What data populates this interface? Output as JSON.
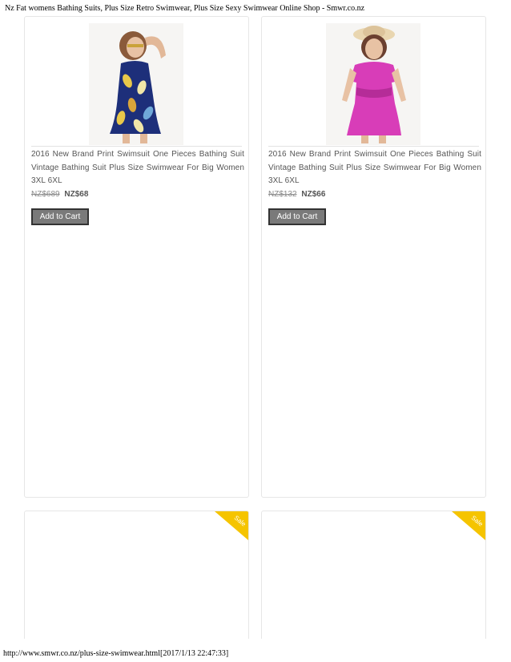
{
  "page": {
    "header_title": "Nz Fat womens Bathing Suits, Plus Size Retro Swimwear, Plus Size Sexy Swimwear Online Shop - Smwr.co.nz",
    "footer_url": "http://www.smwr.co.nz/plus-size-swimwear.html[2017/1/13 22:47:33]"
  },
  "products": [
    {
      "title": "2016 New Brand Print Swimsuit One Pieces Bathing Suit Vintage Bathing Suit Plus Size Swimwear For Big Women 3XL 6XL",
      "old_price": "NZ$689",
      "new_price": "NZ$68",
      "button_label": "Add to Cart",
      "image_alt": "navy leaf-print swim dress"
    },
    {
      "title": "2016 New Brand Print Swimsuit One Pieces Bathing Suit Vintage Bathing Suit Plus Size Swimwear For Big Women 3XL 6XL",
      "old_price": "NZ$132",
      "new_price": "NZ$66",
      "button_label": "Add to Cart",
      "image_alt": "magenta ruffle swim dress with sun hat"
    }
  ],
  "sale_badges": [
    {
      "label": "Sale"
    },
    {
      "label": "Sale"
    }
  ],
  "colors": {
    "sale_badge": "#f5c400",
    "button_bg": "#7a7a7a",
    "card_border": "#e6e6e6"
  }
}
